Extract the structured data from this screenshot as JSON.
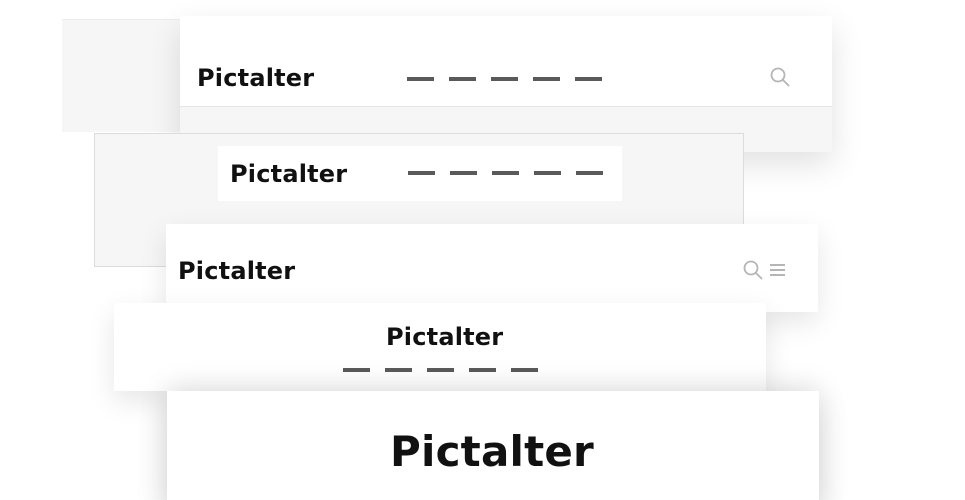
{
  "brand": {
    "name": "Pictalter",
    "nav_color": "#5a5a5a",
    "text_color": "#111111"
  },
  "variants": [
    {
      "id": "header-variant-1",
      "logo": "Pictalter"
    },
    {
      "id": "header-variant-2",
      "logo": "Pictalter",
      "nav_items": 5,
      "icons": [
        "search-icon"
      ]
    },
    {
      "id": "header-variant-3",
      "logo": "Pictalter",
      "nav_items": 5
    },
    {
      "id": "header-variant-4",
      "logo": "Pictalter",
      "icons": [
        "search-icon",
        "menu-icon"
      ]
    },
    {
      "id": "header-variant-5",
      "logo": "Pictalter",
      "nav_items": 5
    },
    {
      "id": "header-variant-6",
      "logo": "Pictalter"
    }
  ]
}
